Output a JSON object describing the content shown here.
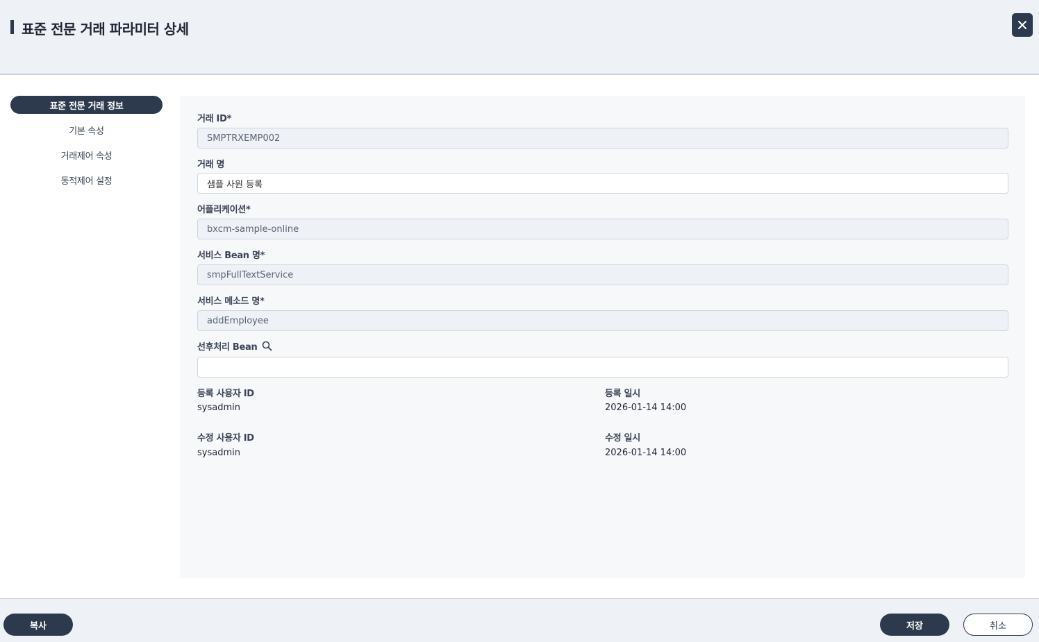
{
  "header": {
    "title": "표준 전문 거래 파라미터 상세"
  },
  "sidebar": {
    "items": [
      {
        "label": "표준 전문 거래 정보"
      },
      {
        "label": "기본 속성"
      },
      {
        "label": "거래제어 속성"
      },
      {
        "label": "동적제어 설정"
      }
    ]
  },
  "form": {
    "trx_id": {
      "label": "거래 ID*",
      "value": "SMPTRXEMP002"
    },
    "trx_name": {
      "label": "거래 명",
      "value": "샘플 사원 등록"
    },
    "application": {
      "label": "어플리케이션*",
      "value": "bxcm-sample-online"
    },
    "service_bean": {
      "label": "서비스 Bean 명*",
      "value": "smpFullTextService"
    },
    "service_method": {
      "label": "서비스 메소드 명*",
      "value": "addEmployee"
    },
    "pre_post_bean": {
      "label": "선후처리 Bean",
      "value": ""
    }
  },
  "meta": {
    "reg_user": {
      "label": "등록 사용자 ID",
      "value": "sysadmin"
    },
    "reg_date": {
      "label": "등록 일시",
      "value": "2026-01-14 14:00"
    },
    "mod_user": {
      "label": "수정 사용자 ID",
      "value": "sysadmin"
    },
    "mod_date": {
      "label": "수정 일시",
      "value": "2026-01-14 14:00"
    }
  },
  "footer": {
    "copy_label": "복사",
    "save_label": "저장",
    "cancel_label": "취소"
  },
  "colors": {
    "primary": "#2d3a4e",
    "header_bg": "#eef1f6",
    "panel_bg": "#f7f8fa"
  },
  "icons": {
    "close": "close-icon",
    "search": "search-icon"
  }
}
